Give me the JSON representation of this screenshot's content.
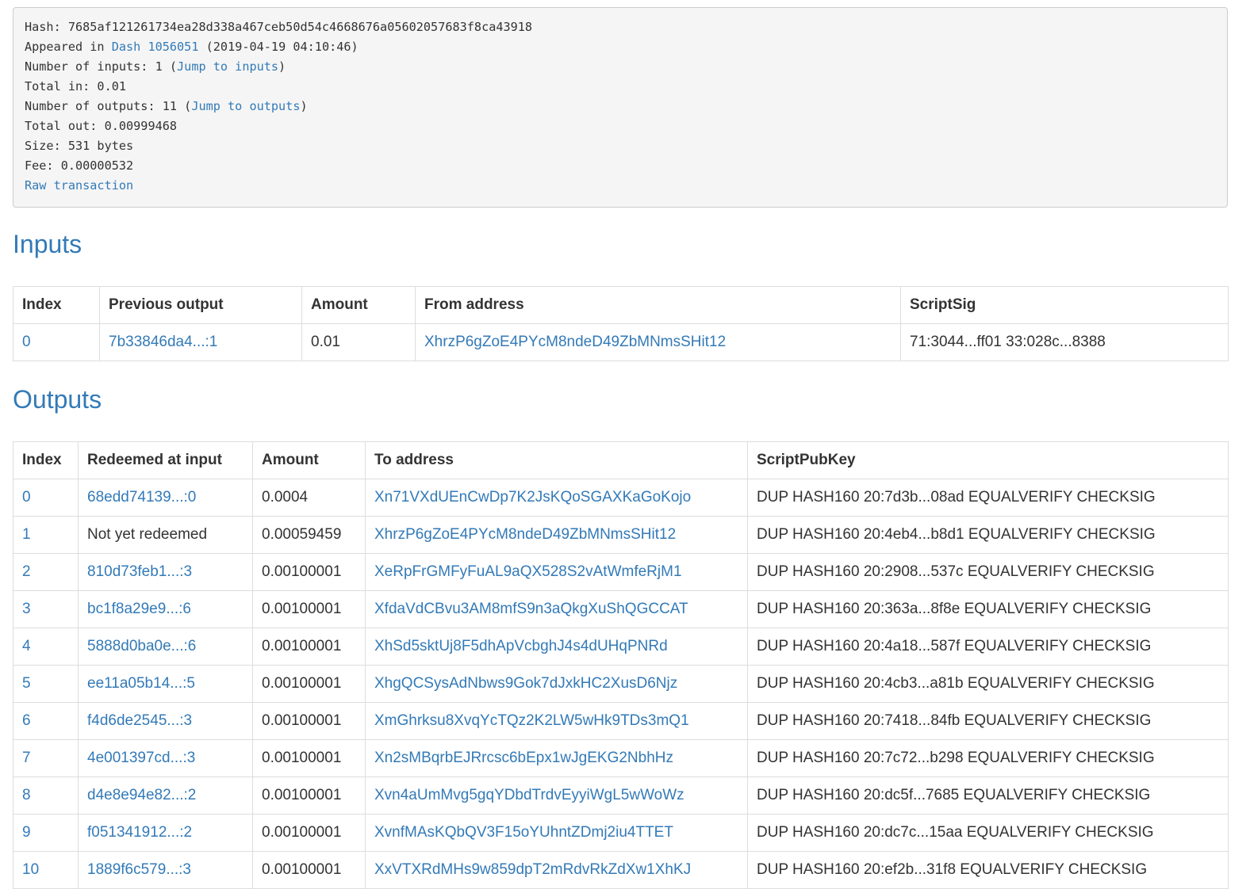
{
  "summary": {
    "hash_label": "Hash:",
    "hash_value": "7685af121261734ea28d338a467ceb50d54c4668676a05602057683f8ca43918",
    "appeared_label": "Appeared in",
    "appeared_block": "Dash 1056051",
    "appeared_time": "(2019-04-19 04:10:46)",
    "num_inputs_label": "Number of inputs: 1 (",
    "jump_inputs": "Jump to inputs",
    "num_inputs_close": ")",
    "total_in": "Total in: 0.01",
    "num_outputs_label": "Number of outputs: 11 (",
    "jump_outputs": "Jump to outputs",
    "num_outputs_close": ")",
    "total_out": "Total out: 0.00999468",
    "size": "Size: 531 bytes",
    "fee": "Fee: 0.00000532",
    "raw_tx": "Raw transaction"
  },
  "inputs": {
    "heading": "Inputs",
    "columns": [
      "Index",
      "Previous output",
      "Amount",
      "From address",
      "ScriptSig"
    ],
    "rows": [
      {
        "index": "0",
        "previous_output": "7b33846da4...:1",
        "amount": "0.01",
        "from_address": "XhrzP6gZoE4PYcM8ndeD49ZbMNmsSHit12",
        "scriptsig": "71:3044...ff01 33:028c...8388"
      }
    ]
  },
  "outputs": {
    "heading": "Outputs",
    "columns": [
      "Index",
      "Redeemed at input",
      "Amount",
      "To address",
      "ScriptPubKey"
    ],
    "rows": [
      {
        "index": "0",
        "redeemed": "68edd74139...:0",
        "redeemed_link": true,
        "amount": "0.0004",
        "to_address": "Xn71VXdUEnCwDp7K2JsKQoSGAXKaGoKojo",
        "script": "DUP HASH160 20:7d3b...08ad EQUALVERIFY CHECKSIG"
      },
      {
        "index": "1",
        "redeemed": "Not yet redeemed",
        "redeemed_link": false,
        "amount": "0.00059459",
        "to_address": "XhrzP6gZoE4PYcM8ndeD49ZbMNmsSHit12",
        "script": "DUP HASH160 20:4eb4...b8d1 EQUALVERIFY CHECKSIG"
      },
      {
        "index": "2",
        "redeemed": "810d73feb1...:3",
        "redeemed_link": true,
        "amount": "0.00100001",
        "to_address": "XeRpFrGMFyFuAL9aQX528S2vAtWmfeRjM1",
        "script": "DUP HASH160 20:2908...537c EQUALVERIFY CHECKSIG"
      },
      {
        "index": "3",
        "redeemed": "bc1f8a29e9...:6",
        "redeemed_link": true,
        "amount": "0.00100001",
        "to_address": "XfdaVdCBvu3AM8mfS9n3aQkgXuShQGCCAT",
        "script": "DUP HASH160 20:363a...8f8e EQUALVERIFY CHECKSIG"
      },
      {
        "index": "4",
        "redeemed": "5888d0ba0e...:6",
        "redeemed_link": true,
        "amount": "0.00100001",
        "to_address": "XhSd5sktUj8F5dhApVcbghJ4s4dUHqPNRd",
        "script": "DUP HASH160 20:4a18...587f EQUALVERIFY CHECKSIG"
      },
      {
        "index": "5",
        "redeemed": "ee11a05b14...:5",
        "redeemed_link": true,
        "amount": "0.00100001",
        "to_address": "XhgQCSysAdNbws9Gok7dJxkHC2XusD6Njz",
        "script": "DUP HASH160 20:4cb3...a81b EQUALVERIFY CHECKSIG"
      },
      {
        "index": "6",
        "redeemed": "f4d6de2545...:3",
        "redeemed_link": true,
        "amount": "0.00100001",
        "to_address": "XmGhrksu8XvqYcTQz2K2LW5wHk9TDs3mQ1",
        "script": "DUP HASH160 20:7418...84fb EQUALVERIFY CHECKSIG"
      },
      {
        "index": "7",
        "redeemed": "4e001397cd...:3",
        "redeemed_link": true,
        "amount": "0.00100001",
        "to_address": "Xn2sMBqrbEJRrcsc6bEpx1wJgEKG2NbhHz",
        "script": "DUP HASH160 20:7c72...b298 EQUALVERIFY CHECKSIG"
      },
      {
        "index": "8",
        "redeemed": "d4e8e94e82...:2",
        "redeemed_link": true,
        "amount": "0.00100001",
        "to_address": "Xvn4aUmMvg5gqYDbdTrdvEyyiWgL5wWoWz",
        "script": "DUP HASH160 20:dc5f...7685 EQUALVERIFY CHECKSIG"
      },
      {
        "index": "9",
        "redeemed": "f051341912...:2",
        "redeemed_link": true,
        "amount": "0.00100001",
        "to_address": "XvnfMAsKQbQV3F15oYUhntZDmj2iu4TTET",
        "script": "DUP HASH160 20:dc7c...15aa EQUALVERIFY CHECKSIG"
      },
      {
        "index": "10",
        "redeemed": "1889f6c579...:3",
        "redeemed_link": true,
        "amount": "0.00100001",
        "to_address": "XxVTXRdMHs9w859dpT2mRdvRkZdXw1XhKJ",
        "script": "DUP HASH160 20:ef2b...31f8 EQUALVERIFY CHECKSIG"
      }
    ]
  }
}
